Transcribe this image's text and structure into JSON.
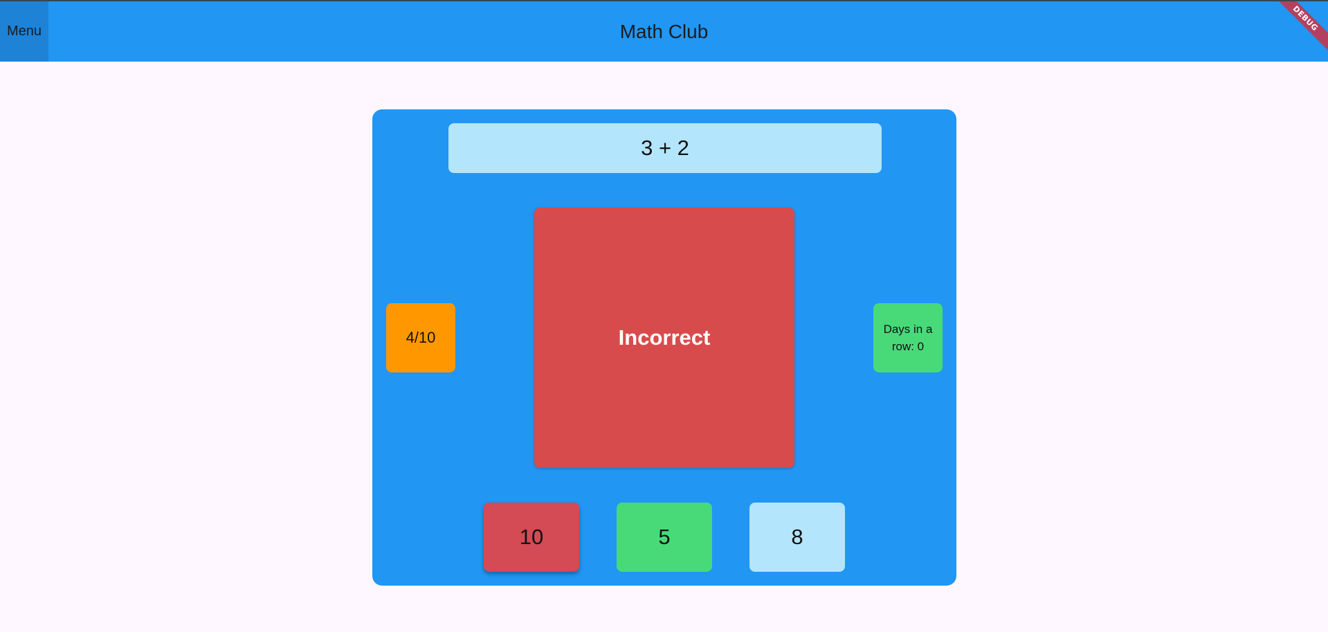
{
  "appbar": {
    "menu_label": "Menu",
    "title": "Math Club",
    "debug_label": "DEBUG"
  },
  "quiz": {
    "question": "3 + 2",
    "result": "Incorrect",
    "progress": "4/10",
    "streak": "Days in a row: 0",
    "answers": [
      {
        "label": "10",
        "state": "selected-wrong"
      },
      {
        "label": "5",
        "state": "correct"
      },
      {
        "label": "8",
        "state": "neutral"
      }
    ]
  },
  "colors": {
    "appbar": "#2196F3",
    "panel": "#2196F3",
    "question_bg": "#B3E5FC",
    "incorrect": "#D84B4D",
    "progress_bg": "#FF9800",
    "streak_bg": "#48DA79",
    "page_bg": "#FEF7FF"
  }
}
